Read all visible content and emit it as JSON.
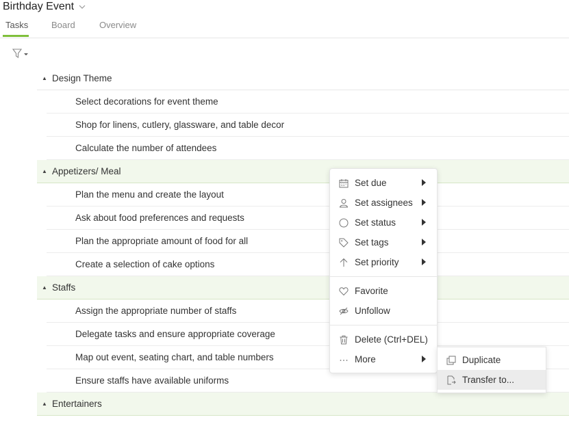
{
  "project": {
    "title": "Birthday Event"
  },
  "tabs": [
    "Tasks",
    "Board",
    "Overview"
  ],
  "groups": [
    {
      "name": "Design Theme",
      "tasks": [
        "Select decorations for event theme",
        "Shop for linens, cutlery, glassware, and table decor",
        "Calculate the number of attendees"
      ]
    },
    {
      "name": "Appetizers/ Meal",
      "tasks": [
        "Plan the menu and create the layout",
        "Ask about food preferences and requests",
        "Plan the appropriate amount of food for all",
        "Create a selection of cake options"
      ]
    },
    {
      "name": "Staffs",
      "tasks": [
        "Assign the appropriate number of staffs",
        "Delegate tasks and ensure appropriate coverage",
        "Map out event, seating chart, and table numbers",
        "Ensure staffs have available uniforms"
      ]
    },
    {
      "name": "Entertainers",
      "tasks": []
    }
  ],
  "context_menu": {
    "items": [
      {
        "label": "Set due",
        "icon": "calendar-icon",
        "submenu": true
      },
      {
        "label": "Set assignees",
        "icon": "person-icon",
        "submenu": true
      },
      {
        "label": "Set status",
        "icon": "circle-icon",
        "submenu": true
      },
      {
        "label": "Set tags",
        "icon": "tag-icon",
        "submenu": true
      },
      {
        "label": "Set priority",
        "icon": "arrow-up-icon",
        "submenu": true
      },
      {
        "label": "Favorite",
        "icon": "heart-icon",
        "submenu": false
      },
      {
        "label": "Unfollow",
        "icon": "eye-off-icon",
        "submenu": false
      },
      {
        "label": "Delete (Ctrl+DEL)",
        "icon": "trash-icon",
        "submenu": false
      },
      {
        "label": "More",
        "icon": "ellipsis-icon",
        "submenu": true
      }
    ]
  },
  "submenu": {
    "items": [
      {
        "label": "Duplicate",
        "icon": "duplicate-icon"
      },
      {
        "label": "Transfer to...",
        "icon": "transfer-icon"
      }
    ],
    "highlighted": "Transfer to..."
  }
}
